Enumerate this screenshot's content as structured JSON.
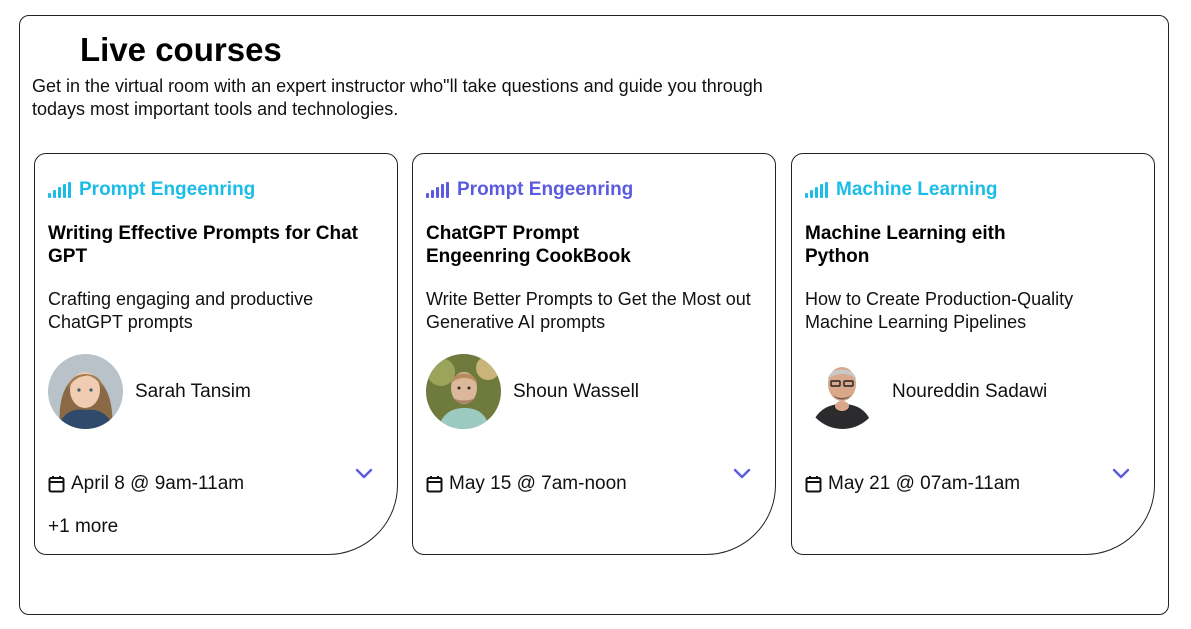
{
  "page": {
    "title": "Live courses",
    "subtitle": "Get in the virtual room with an expert instructor who\"ll take questions and guide you through todays most important tools and technologies."
  },
  "courses": [
    {
      "category": "Prompt Engeenring",
      "category_color": "#1bbde8",
      "title": "Writing Effective Prompts for Chat GPT",
      "description": "Crafting engaging and productive ChatGPT prompts",
      "instructor": "Sarah Tansim",
      "date": "April 8 @ 9am-11am",
      "more": "+1 more"
    },
    {
      "category": "Prompt Engeenring",
      "category_color": "#5b5be0",
      "title": "ChatGPT Prompt Engeenring CookBook",
      "description": "Write Better Prompts to Get the Most out Generative AI prompts",
      "instructor": "Shoun Wassell",
      "date": "May 15 @ 7am-noon"
    },
    {
      "category": "Machine Learning",
      "category_color": "#1bbde8",
      "title": "Machine Learning eith Python",
      "description": "How to Create Production-Quality Machine Learning Pipelines",
      "instructor": "Noureddin Sadawi",
      "date": "May 21 @ 07am-11am"
    }
  ],
  "colors": {
    "chevron": "#5b5be0",
    "border": "#222222"
  },
  "icons": {
    "category": "signal-bars-icon",
    "date": "calendar-icon",
    "expand": "chevron-down-icon"
  }
}
